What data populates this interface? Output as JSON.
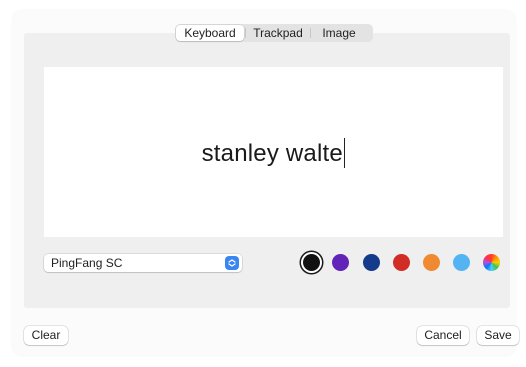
{
  "tabs": [
    {
      "label": "Keyboard",
      "selected": true
    },
    {
      "label": "Trackpad",
      "selected": false
    },
    {
      "label": "Image",
      "selected": false
    }
  ],
  "signature": {
    "text": "stanley walte"
  },
  "font_select": {
    "value": "PingFang SC",
    "icon": "chevron-updown-icon"
  },
  "colors": [
    {
      "name": "black",
      "hex": "#111111",
      "selected": true
    },
    {
      "name": "purple",
      "hex": "#6223b8",
      "selected": false
    },
    {
      "name": "navy",
      "hex": "#143a8c",
      "selected": false
    },
    {
      "name": "red",
      "hex": "#d12d26",
      "selected": false
    },
    {
      "name": "orange",
      "hex": "#ef8a33",
      "selected": false
    },
    {
      "name": "light-blue",
      "hex": "#54b3f2",
      "selected": false
    },
    {
      "name": "color-wheel",
      "hex": "multicolor",
      "selected": false
    }
  ],
  "buttons": {
    "clear": "Clear",
    "cancel": "Cancel",
    "save": "Save"
  }
}
